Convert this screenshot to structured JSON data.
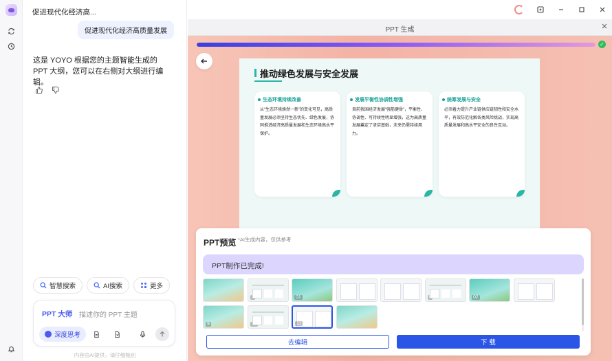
{
  "chat": {
    "title": "促进现代化经济高...",
    "user_message": "促进现代化经济高质量发展",
    "ai_message": "这是 YOYO 根据您的主题智能生成的 PPT 大纲，您可以在右侧对大纲进行编辑。",
    "chips": [
      {
        "label": "智慧搜索",
        "icon": "search-icon"
      },
      {
        "label": "AI搜索",
        "icon": "ai-search-icon"
      },
      {
        "label": "更多",
        "icon": "more-grid-icon"
      }
    ],
    "input": {
      "mode_label": "PPT 大师",
      "placeholder": "描述你的 PPT 主题",
      "deep_think_label": "深度思考"
    },
    "disclaimer": "内容由AI提供，请仔细甄别"
  },
  "window": {
    "panel_title": "PPT 生成"
  },
  "progress": {
    "value": 1.0
  },
  "slide": {
    "title": "推动绿色发展与安全发展",
    "cards": [
      {
        "heading": "生态环境持续改善",
        "body": "从“生态环境焕然一新”的变化可见，高质量发展必须坚持生态优先、绿色发展，协同推进经济高质量发展和生态环境高水平保护。"
      },
      {
        "heading": "发展平衡性协调性增强",
        "body": "目前我国经济发展“强筋健骨”，平衡性、协调性、可持续性明显增强，这为高质量发展奠定了坚实基础，未来仍需持续用力。"
      },
      {
        "heading": "统筹发展与安全",
        "body": "必须着力提升产业链供应链韧性和安全水平，有效防范化解各类风险挑战，实现高质量发展和高水平安全的良性互动。"
      }
    ]
  },
  "preview": {
    "title": "PPT预览",
    "note": "*AI生成内容，仅供参考",
    "status": "PPT制作已完成!",
    "thumbnails": [
      {
        "num": "",
        "style": "a"
      },
      {
        "num": "2",
        "style": "b"
      },
      {
        "num": "01",
        "style": "c"
      },
      {
        "num": "",
        "style": "d"
      },
      {
        "num": "",
        "style": "d"
      },
      {
        "num": "6",
        "style": "b"
      },
      {
        "num": "02",
        "style": "c"
      },
      {
        "num": "",
        "style": "d"
      },
      {
        "num": "9",
        "style": "a"
      },
      {
        "num": "10",
        "style": "b"
      },
      {
        "num": "11",
        "style": "d"
      },
      {
        "num": "",
        "style": "a"
      }
    ],
    "edit_label": "去编辑",
    "download_label": "下 载"
  },
  "colors": {
    "accent": "#2b55e6",
    "teal": "#2bb5a6",
    "success": "#2ebd5b"
  }
}
